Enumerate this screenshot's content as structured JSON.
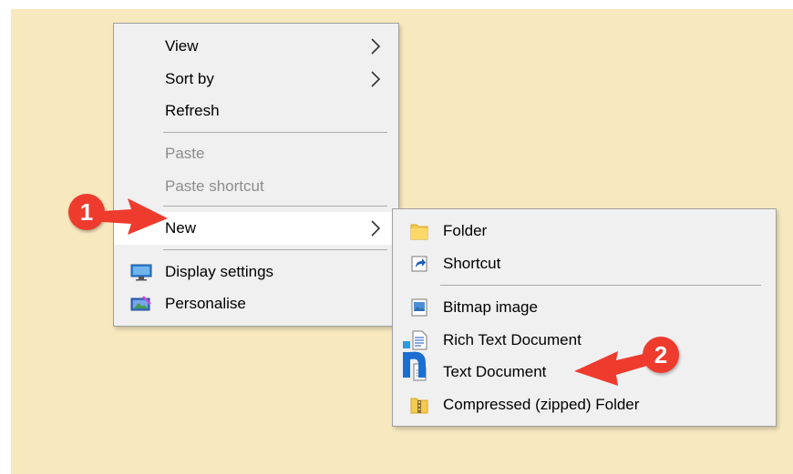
{
  "context_menu": {
    "items": [
      {
        "label": "View",
        "has_submenu": true,
        "disabled": false
      },
      {
        "label": "Sort by",
        "has_submenu": true,
        "disabled": false
      },
      {
        "label": "Refresh",
        "has_submenu": false,
        "disabled": false
      },
      {
        "label": "Paste",
        "has_submenu": false,
        "disabled": true
      },
      {
        "label": "Paste shortcut",
        "has_submenu": false,
        "disabled": true
      },
      {
        "label": "New",
        "has_submenu": true,
        "disabled": false,
        "highlighted": true
      },
      {
        "label": "Display settings",
        "icon": "display-settings-icon"
      },
      {
        "label": "Personalise",
        "icon": "personalise-icon"
      }
    ]
  },
  "new_submenu": {
    "items": [
      {
        "label": "Folder",
        "icon": "folder-icon"
      },
      {
        "label": "Shortcut",
        "icon": "shortcut-icon"
      },
      {
        "label": "Bitmap image",
        "icon": "bitmap-image-icon"
      },
      {
        "label": "Rich Text Document",
        "icon": "rich-text-document-icon"
      },
      {
        "label": "Text Document",
        "icon": "text-document-icon"
      },
      {
        "label": "Compressed (zipped) Folder",
        "icon": "zip-folder-icon"
      }
    ]
  },
  "annotations": {
    "step1": "1",
    "step2": "2",
    "badge_color": "#ef3b2e"
  },
  "colors": {
    "desktop": "#f7e8be",
    "menu_bg": "#f0f0f0",
    "disabled_text": "#8d8d8d"
  }
}
